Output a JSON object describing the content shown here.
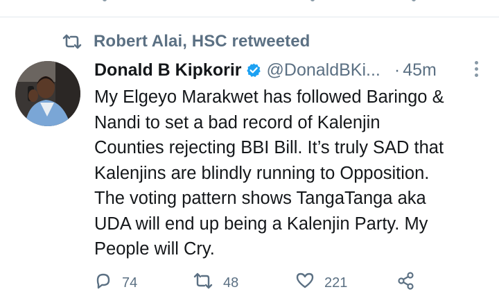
{
  "retweet": {
    "label": "Robert Alai, HSC retweeted",
    "icon": "retweet-icon"
  },
  "tweet": {
    "author": {
      "display_name": "Donald B Kipkorir",
      "handle": "@DonaldBKi...",
      "verified": true,
      "avatar_icon": "profile-photo"
    },
    "separator": "·",
    "time": "45m",
    "text_lines": [
      "My Elgeyo Marakwet has followed Baringo &",
      "Nandi to set a bad record of Kalenjin",
      "Counties rejecting BBI Bill. It’s truly SAD that",
      "Kalenjins are blindly running to Opposition.",
      "The voting pattern shows TangaTanga aka",
      "UDA will end up being a Kalenjin Party. My",
      "People will Cry."
    ],
    "actions": {
      "reply": {
        "icon": "reply-icon",
        "count": "74"
      },
      "retweet": {
        "icon": "retweet-icon",
        "count": "48"
      },
      "like": {
        "icon": "heart-icon",
        "count": "221"
      },
      "share": {
        "icon": "share-icon"
      }
    }
  },
  "colors": {
    "text": "#14171a",
    "secondary": "#5b7083",
    "verified_badge": "#1da1f2",
    "divider": "#e1e8ed"
  }
}
